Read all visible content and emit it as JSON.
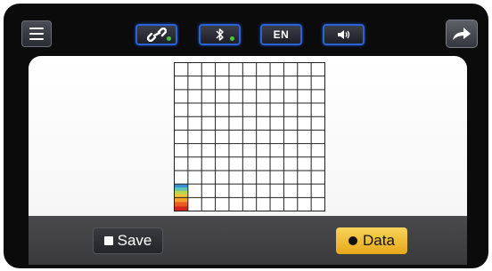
{
  "topbar": {
    "menu_icon": "hamburger-menu-icon",
    "toggles": [
      {
        "name": "link",
        "icon": "link-icon",
        "active": true,
        "indicator_color": "#43c83b"
      },
      {
        "name": "bluetooth",
        "icon": "bluetooth-icon",
        "active": true,
        "indicator_color": "#43c83b"
      },
      {
        "name": "language",
        "label": "EN"
      },
      {
        "name": "volume",
        "icon": "speaker-icon"
      }
    ],
    "share_icon": "share-arrow-icon",
    "accent_color": "#2a63d8"
  },
  "grid": {
    "columns": 11,
    "rows": 11,
    "filled_cells": [
      {
        "col": 0,
        "row": 9,
        "colors": [
          "#3a8fd0",
          "#5fc3b6",
          "#b7d64a",
          "#f0c23a"
        ]
      },
      {
        "col": 0,
        "row": 10,
        "colors": [
          "#f3a12d",
          "#ea5b22",
          "#d1261f"
        ]
      }
    ]
  },
  "footer": {
    "save_label": "Save",
    "data_label": "Data",
    "data_active_color": "#f2c43a"
  }
}
